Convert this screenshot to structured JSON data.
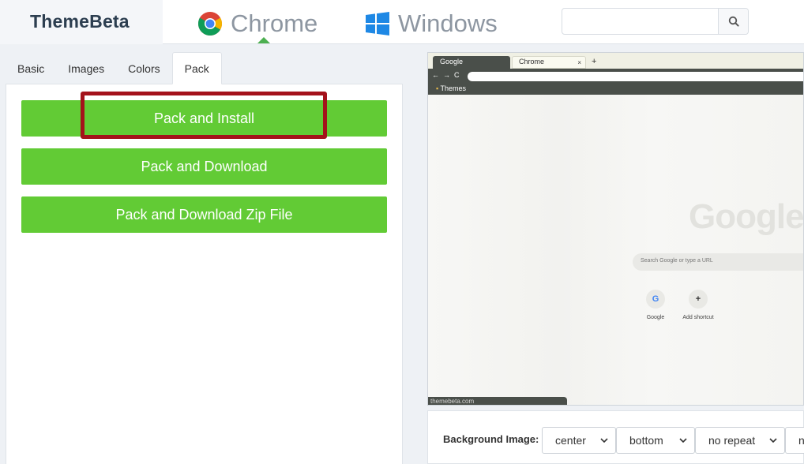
{
  "header": {
    "logo": "ThemeBeta",
    "nav": [
      {
        "label": "Chrome"
      },
      {
        "label": "Windows"
      }
    ],
    "search": {
      "value": "",
      "placeholder": ""
    }
  },
  "tabs": [
    {
      "label": "Basic"
    },
    {
      "label": "Images"
    },
    {
      "label": "Colors"
    },
    {
      "label": "Pack",
      "active": true
    }
  ],
  "actions": {
    "install": "Pack and Install",
    "download": "Pack and Download",
    "zip": "Pack and Download Zip File"
  },
  "preview": {
    "tab_active": "Google",
    "tab_second": "Chrome",
    "tab_close": "×",
    "new_tab": "+",
    "nav_back": "←",
    "nav_forward": "→",
    "nav_reload": "C",
    "bookmark": "Themes",
    "logo": "Google",
    "search_placeholder": "Search Google or type a URL",
    "shortcuts": [
      {
        "icon_text": "G",
        "label": "Google"
      },
      {
        "icon_text": "+",
        "label": "Add shortcut"
      }
    ],
    "footer": "themebeta.com"
  },
  "background_image": {
    "label": "Background Image:",
    "selects": [
      {
        "value": "center"
      },
      {
        "value": "bottom"
      },
      {
        "value": "no repeat"
      },
      {
        "value": "n"
      }
    ]
  },
  "colors": {
    "accent_green": "#62cb35",
    "highlight_red": "#a4121b",
    "preview_toolbar": "#4a4f4a"
  }
}
